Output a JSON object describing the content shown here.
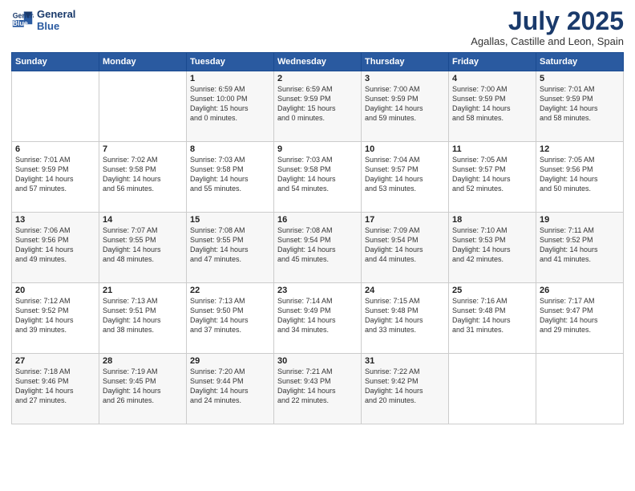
{
  "header": {
    "logo_line1": "General",
    "logo_line2": "Blue",
    "title": "July 2025",
    "subtitle": "Agallas, Castille and Leon, Spain"
  },
  "days_of_week": [
    "Sunday",
    "Monday",
    "Tuesday",
    "Wednesday",
    "Thursday",
    "Friday",
    "Saturday"
  ],
  "weeks": [
    [
      {
        "day": "",
        "content": ""
      },
      {
        "day": "",
        "content": ""
      },
      {
        "day": "1",
        "content": "Sunrise: 6:59 AM\nSunset: 10:00 PM\nDaylight: 15 hours\nand 0 minutes."
      },
      {
        "day": "2",
        "content": "Sunrise: 6:59 AM\nSunset: 9:59 PM\nDaylight: 15 hours\nand 0 minutes."
      },
      {
        "day": "3",
        "content": "Sunrise: 7:00 AM\nSunset: 9:59 PM\nDaylight: 14 hours\nand 59 minutes."
      },
      {
        "day": "4",
        "content": "Sunrise: 7:00 AM\nSunset: 9:59 PM\nDaylight: 14 hours\nand 58 minutes."
      },
      {
        "day": "5",
        "content": "Sunrise: 7:01 AM\nSunset: 9:59 PM\nDaylight: 14 hours\nand 58 minutes."
      }
    ],
    [
      {
        "day": "6",
        "content": "Sunrise: 7:01 AM\nSunset: 9:59 PM\nDaylight: 14 hours\nand 57 minutes."
      },
      {
        "day": "7",
        "content": "Sunrise: 7:02 AM\nSunset: 9:58 PM\nDaylight: 14 hours\nand 56 minutes."
      },
      {
        "day": "8",
        "content": "Sunrise: 7:03 AM\nSunset: 9:58 PM\nDaylight: 14 hours\nand 55 minutes."
      },
      {
        "day": "9",
        "content": "Sunrise: 7:03 AM\nSunset: 9:58 PM\nDaylight: 14 hours\nand 54 minutes."
      },
      {
        "day": "10",
        "content": "Sunrise: 7:04 AM\nSunset: 9:57 PM\nDaylight: 14 hours\nand 53 minutes."
      },
      {
        "day": "11",
        "content": "Sunrise: 7:05 AM\nSunset: 9:57 PM\nDaylight: 14 hours\nand 52 minutes."
      },
      {
        "day": "12",
        "content": "Sunrise: 7:05 AM\nSunset: 9:56 PM\nDaylight: 14 hours\nand 50 minutes."
      }
    ],
    [
      {
        "day": "13",
        "content": "Sunrise: 7:06 AM\nSunset: 9:56 PM\nDaylight: 14 hours\nand 49 minutes."
      },
      {
        "day": "14",
        "content": "Sunrise: 7:07 AM\nSunset: 9:55 PM\nDaylight: 14 hours\nand 48 minutes."
      },
      {
        "day": "15",
        "content": "Sunrise: 7:08 AM\nSunset: 9:55 PM\nDaylight: 14 hours\nand 47 minutes."
      },
      {
        "day": "16",
        "content": "Sunrise: 7:08 AM\nSunset: 9:54 PM\nDaylight: 14 hours\nand 45 minutes."
      },
      {
        "day": "17",
        "content": "Sunrise: 7:09 AM\nSunset: 9:54 PM\nDaylight: 14 hours\nand 44 minutes."
      },
      {
        "day": "18",
        "content": "Sunrise: 7:10 AM\nSunset: 9:53 PM\nDaylight: 14 hours\nand 42 minutes."
      },
      {
        "day": "19",
        "content": "Sunrise: 7:11 AM\nSunset: 9:52 PM\nDaylight: 14 hours\nand 41 minutes."
      }
    ],
    [
      {
        "day": "20",
        "content": "Sunrise: 7:12 AM\nSunset: 9:52 PM\nDaylight: 14 hours\nand 39 minutes."
      },
      {
        "day": "21",
        "content": "Sunrise: 7:13 AM\nSunset: 9:51 PM\nDaylight: 14 hours\nand 38 minutes."
      },
      {
        "day": "22",
        "content": "Sunrise: 7:13 AM\nSunset: 9:50 PM\nDaylight: 14 hours\nand 37 minutes."
      },
      {
        "day": "23",
        "content": "Sunrise: 7:14 AM\nSunset: 9:49 PM\nDaylight: 14 hours\nand 34 minutes."
      },
      {
        "day": "24",
        "content": "Sunrise: 7:15 AM\nSunset: 9:48 PM\nDaylight: 14 hours\nand 33 minutes."
      },
      {
        "day": "25",
        "content": "Sunrise: 7:16 AM\nSunset: 9:48 PM\nDaylight: 14 hours\nand 31 minutes."
      },
      {
        "day": "26",
        "content": "Sunrise: 7:17 AM\nSunset: 9:47 PM\nDaylight: 14 hours\nand 29 minutes."
      }
    ],
    [
      {
        "day": "27",
        "content": "Sunrise: 7:18 AM\nSunset: 9:46 PM\nDaylight: 14 hours\nand 27 minutes."
      },
      {
        "day": "28",
        "content": "Sunrise: 7:19 AM\nSunset: 9:45 PM\nDaylight: 14 hours\nand 26 minutes."
      },
      {
        "day": "29",
        "content": "Sunrise: 7:20 AM\nSunset: 9:44 PM\nDaylight: 14 hours\nand 24 minutes."
      },
      {
        "day": "30",
        "content": "Sunrise: 7:21 AM\nSunset: 9:43 PM\nDaylight: 14 hours\nand 22 minutes."
      },
      {
        "day": "31",
        "content": "Sunrise: 7:22 AM\nSunset: 9:42 PM\nDaylight: 14 hours\nand 20 minutes."
      },
      {
        "day": "",
        "content": ""
      },
      {
        "day": "",
        "content": ""
      }
    ]
  ]
}
